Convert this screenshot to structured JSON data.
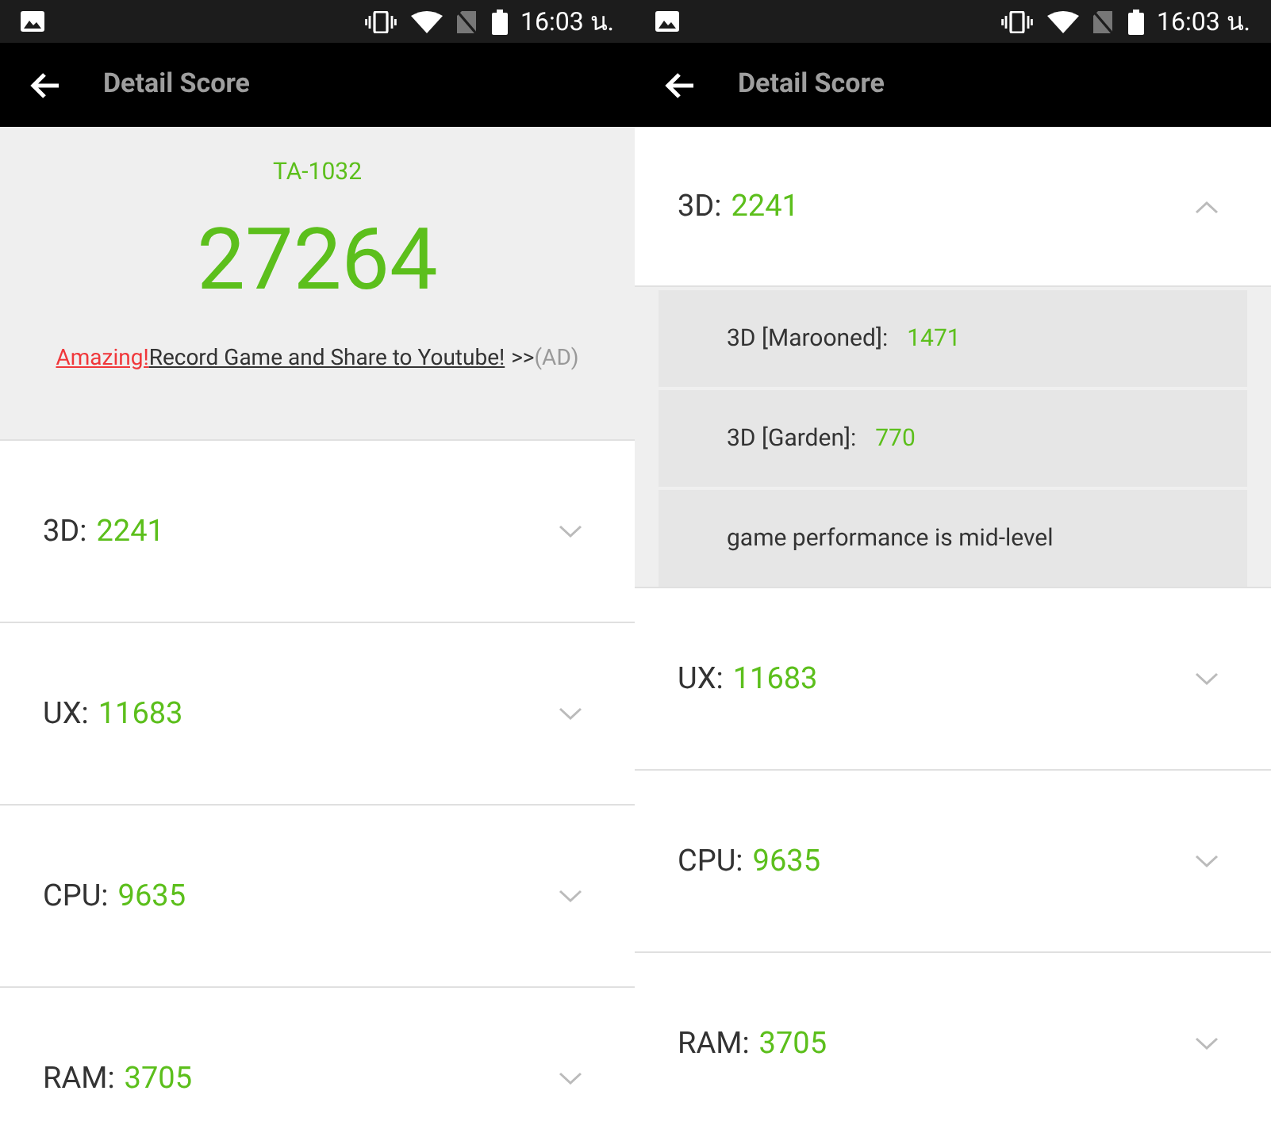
{
  "screens": [
    {
      "status_bar": {
        "time": "16:03 น."
      },
      "title": "Detail Score",
      "summary": {
        "device": "TA-1032",
        "score": "27264",
        "ad": {
          "highlight": "Amazing!",
          "link": "Record Game and Share to Youtube!",
          "arrows": ">>",
          "tag": "(AD)"
        }
      },
      "sections": [
        {
          "label": "3D:",
          "score": "2241",
          "expanded": false
        },
        {
          "label": "UX:",
          "score": "11683",
          "expanded": false
        },
        {
          "label": "CPU:",
          "score": "9635",
          "expanded": false
        },
        {
          "label": "RAM:",
          "score": "3705",
          "expanded": false
        }
      ]
    },
    {
      "status_bar": {
        "time": "16:03 น."
      },
      "title": "Detail Score",
      "sections": [
        {
          "label": "3D:",
          "score": "2241",
          "expanded": true,
          "details": [
            {
              "kind": "score",
              "label": "3D [Marooned]:",
              "value": "1471"
            },
            {
              "kind": "score",
              "label": "3D [Garden]:",
              "value": "770"
            },
            {
              "kind": "note",
              "text": "game performance is mid-level"
            }
          ]
        },
        {
          "label": "UX:",
          "score": "11683",
          "expanded": false
        },
        {
          "label": "CPU:",
          "score": "9635",
          "expanded": false
        },
        {
          "label": "RAM:",
          "score": "3705",
          "expanded": false
        }
      ]
    }
  ]
}
